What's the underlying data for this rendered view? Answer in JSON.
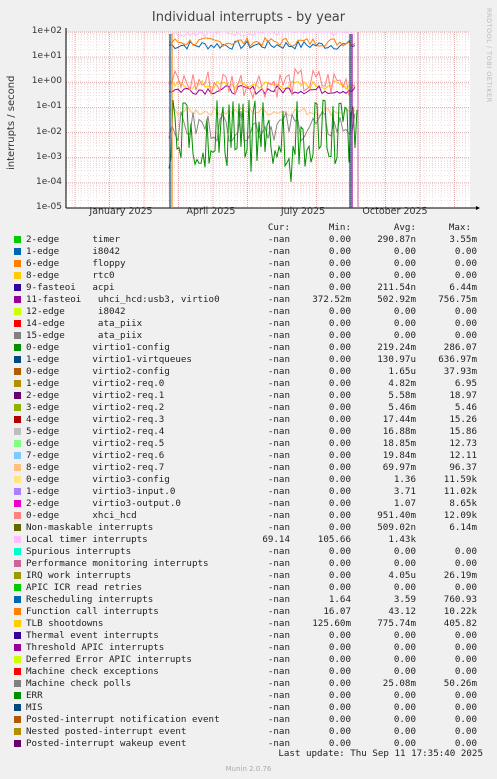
{
  "title": "Individual interrupts - by year",
  "side_text": "RRDTOOL / TOBI OETIKER",
  "ylabel": "interrupts / second",
  "columns": {
    "cur": "Cur:",
    "min": "Min:",
    "avg": "Avg:",
    "max": "Max:"
  },
  "last_update": "Last update: Thu Sep 11 17:35:40 2025",
  "footer": "Munin 2.0.76",
  "chart_data": {
    "type": "line",
    "title": "Individual interrupts - by year",
    "ylabel": "interrupts / second",
    "y_scale": "log",
    "ylim": [
      1e-05,
      100
    ],
    "y_ticks": [
      100,
      10,
      1,
      0.1,
      0.01,
      0.001,
      0.0001,
      1e-05
    ],
    "y_tick_labels": [
      "1e+02",
      "1e+01",
      "1e+00",
      "1e-01",
      "1e-02",
      "1e-03",
      "1e-04",
      "1e-05"
    ],
    "x_tick_labels": [
      "January 2025",
      "April 2025",
      "July 2025",
      "October 2025"
    ],
    "grid": true,
    "approx_levels": [
      {
        "name": "Rescheduling interrupts",
        "value": 30
      },
      {
        "name": "Function call interrupts",
        "value": 40
      },
      {
        "name": "Local timer interrupts",
        "value": 100
      },
      {
        "name": "virtio2-req.7",
        "value": 0.07
      },
      {
        "name": "TLB shootdowns",
        "value": 0.78
      },
      {
        "name": "11-fasteoi uhci_hcd:usb3, virtio0",
        "value": 0.5
      },
      {
        "name": "xhci_hcd",
        "value": 0.95
      },
      {
        "name": "virtio2-req.x",
        "value": 0.018
      }
    ]
  },
  "legend": [
    {
      "label": "2-edge      timer",
      "color": "#00cc00",
      "cur": "-nan",
      "min": "0.00",
      "avg": "290.87n",
      "max": "3.55m"
    },
    {
      "label": "1-edge      i8042",
      "color": "#0066b3",
      "cur": "-nan",
      "min": "0.00",
      "avg": "0.00",
      "max": "0.00"
    },
    {
      "label": "6-edge      floppy",
      "color": "#ff8000",
      "cur": "-nan",
      "min": "0.00",
      "avg": "0.00",
      "max": "0.00"
    },
    {
      "label": "8-edge      rtc0",
      "color": "#ffcc00",
      "cur": "-nan",
      "min": "0.00",
      "avg": "0.00",
      "max": "0.00"
    },
    {
      "label": "9-fasteoi   acpi",
      "color": "#330099",
      "cur": "-nan",
      "min": "0.00",
      "avg": "211.54n",
      "max": "6.44m"
    },
    {
      "label": "11-fasteoi   uhci_hcd:usb3, virtio0",
      "color": "#990099",
      "cur": "-nan",
      "min": "372.52m",
      "avg": "502.92m",
      "max": "756.75m"
    },
    {
      "label": "12-edge      i8042",
      "color": "#ccff00",
      "cur": "-nan",
      "min": "0.00",
      "avg": "0.00",
      "max": "0.00"
    },
    {
      "label": "14-edge      ata_piix",
      "color": "#ff0000",
      "cur": "-nan",
      "min": "0.00",
      "avg": "0.00",
      "max": "0.00"
    },
    {
      "label": "15-edge      ata_piix",
      "color": "#808080",
      "cur": "-nan",
      "min": "0.00",
      "avg": "0.00",
      "max": "0.00"
    },
    {
      "label": "0-edge      virtio1-config",
      "color": "#008f00",
      "cur": "-nan",
      "min": "0.00",
      "avg": "219.24m",
      "max": "286.07"
    },
    {
      "label": "1-edge      virtio1-virtqueues",
      "color": "#00487d",
      "cur": "-nan",
      "min": "0.00",
      "avg": "130.97u",
      "max": "636.97m"
    },
    {
      "label": "0-edge      virtio2-config",
      "color": "#b35a00",
      "cur": "-nan",
      "min": "0.00",
      "avg": "1.65u",
      "max": "37.93m"
    },
    {
      "label": "1-edge      virtio2-req.0",
      "color": "#b38f00",
      "cur": "-nan",
      "min": "0.00",
      "avg": "4.82m",
      "max": "6.95"
    },
    {
      "label": "2-edge      virtio2-req.1",
      "color": "#6b006b",
      "cur": "-nan",
      "min": "0.00",
      "avg": "5.58m",
      "max": "18.97"
    },
    {
      "label": "3-edge      virtio2-req.2",
      "color": "#8fb300",
      "cur": "-nan",
      "min": "0.00",
      "avg": "5.46m",
      "max": "5.46"
    },
    {
      "label": "4-edge      virtio2-req.3",
      "color": "#b30000",
      "cur": "-nan",
      "min": "0.00",
      "avg": "17.44m",
      "max": "15.26"
    },
    {
      "label": "5-edge      virtio2-req.4",
      "color": "#bebebe",
      "cur": "-nan",
      "min": "0.00",
      "avg": "16.88m",
      "max": "15.86"
    },
    {
      "label": "6-edge      virtio2-req.5",
      "color": "#80ff80",
      "cur": "-nan",
      "min": "0.00",
      "avg": "18.85m",
      "max": "12.73"
    },
    {
      "label": "7-edge      virtio2-req.6",
      "color": "#80c9ff",
      "cur": "-nan",
      "min": "0.00",
      "avg": "19.84m",
      "max": "12.11"
    },
    {
      "label": "8-edge      virtio2-req.7",
      "color": "#ffc080",
      "cur": "-nan",
      "min": "0.00",
      "avg": "69.97m",
      "max": "96.37"
    },
    {
      "label": "0-edge      virtio3-config",
      "color": "#ffe680",
      "cur": "-nan",
      "min": "0.00",
      "avg": "1.36",
      "max": "11.59k"
    },
    {
      "label": "1-edge      virtio3-input.0",
      "color": "#aa80ff",
      "cur": "-nan",
      "min": "0.00",
      "avg": "3.71",
      "max": "11.02k"
    },
    {
      "label": "2-edge      virtio3-output.0",
      "color": "#ee00cc",
      "cur": "-nan",
      "min": "0.00",
      "avg": "1.07",
      "max": "8.65k"
    },
    {
      "label": "0-edge      xhci_hcd",
      "color": "#ff8080",
      "cur": "-nan",
      "min": "0.00",
      "avg": "951.40m",
      "max": "12.09k"
    },
    {
      "label": "Non-maskable interrupts",
      "color": "#666600",
      "cur": "-nan",
      "min": "0.00",
      "avg": "509.02n",
      "max": "6.14m"
    },
    {
      "label": "Local timer interrupts",
      "color": "#ffbfff",
      "cur": "69.14",
      "min": "105.66",
      "avg": "1.43k",
      "max": ""
    },
    {
      "label": "Spurious interrupts",
      "color": "#00ffcc",
      "cur": "-nan",
      "min": "0.00",
      "avg": "0.00",
      "max": "0.00"
    },
    {
      "label": "Performance monitoring interrupts",
      "color": "#cc6699",
      "cur": "-nan",
      "min": "0.00",
      "avg": "0.00",
      "max": "0.00"
    },
    {
      "label": "IRQ work interrupts",
      "color": "#999900",
      "cur": "-nan",
      "min": "0.00",
      "avg": "4.05u",
      "max": "26.19m"
    },
    {
      "label": "APIC ICR read retries",
      "color": "#00cc00",
      "cur": "-nan",
      "min": "0.00",
      "avg": "0.00",
      "max": "0.00"
    },
    {
      "label": "Rescheduling interrupts",
      "color": "#0066b3",
      "cur": "-nan",
      "min": "1.64",
      "avg": "3.59",
      "max": "760.93"
    },
    {
      "label": "Function call interrupts",
      "color": "#ff8000",
      "cur": "-nan",
      "min": "16.07",
      "avg": "43.12",
      "max": "10.22k"
    },
    {
      "label": "TLB shootdowns",
      "color": "#ffcc00",
      "cur": "-nan",
      "min": "125.60m",
      "avg": "775.74m",
      "max": "405.82"
    },
    {
      "label": "Thermal event interrupts",
      "color": "#330099",
      "cur": "-nan",
      "min": "0.00",
      "avg": "0.00",
      "max": "0.00"
    },
    {
      "label": "Threshold APIC interrupts",
      "color": "#990099",
      "cur": "-nan",
      "min": "0.00",
      "avg": "0.00",
      "max": "0.00"
    },
    {
      "label": "Deferred Error APIC interrupts",
      "color": "#ccff00",
      "cur": "-nan",
      "min": "0.00",
      "avg": "0.00",
      "max": "0.00"
    },
    {
      "label": "Machine check exceptions",
      "color": "#ff0000",
      "cur": "-nan",
      "min": "0.00",
      "avg": "0.00",
      "max": "0.00"
    },
    {
      "label": "Machine check polls",
      "color": "#808080",
      "cur": "-nan",
      "min": "0.00",
      "avg": "25.08m",
      "max": "50.26m"
    },
    {
      "label": "ERR",
      "color": "#008f00",
      "cur": "-nan",
      "min": "0.00",
      "avg": "0.00",
      "max": "0.00"
    },
    {
      "label": "MIS",
      "color": "#00487d",
      "cur": "-nan",
      "min": "0.00",
      "avg": "0.00",
      "max": "0.00"
    },
    {
      "label": "Posted-interrupt notification event",
      "color": "#b35a00",
      "cur": "-nan",
      "min": "0.00",
      "avg": "0.00",
      "max": "0.00"
    },
    {
      "label": "Nested posted-interrupt event",
      "color": "#b38f00",
      "cur": "-nan",
      "min": "0.00",
      "avg": "0.00",
      "max": "0.00"
    },
    {
      "label": "Posted-interrupt wakeup event",
      "color": "#6b006b",
      "cur": "-nan",
      "min": "0.00",
      "avg": "0.00",
      "max": "0.00"
    }
  ]
}
